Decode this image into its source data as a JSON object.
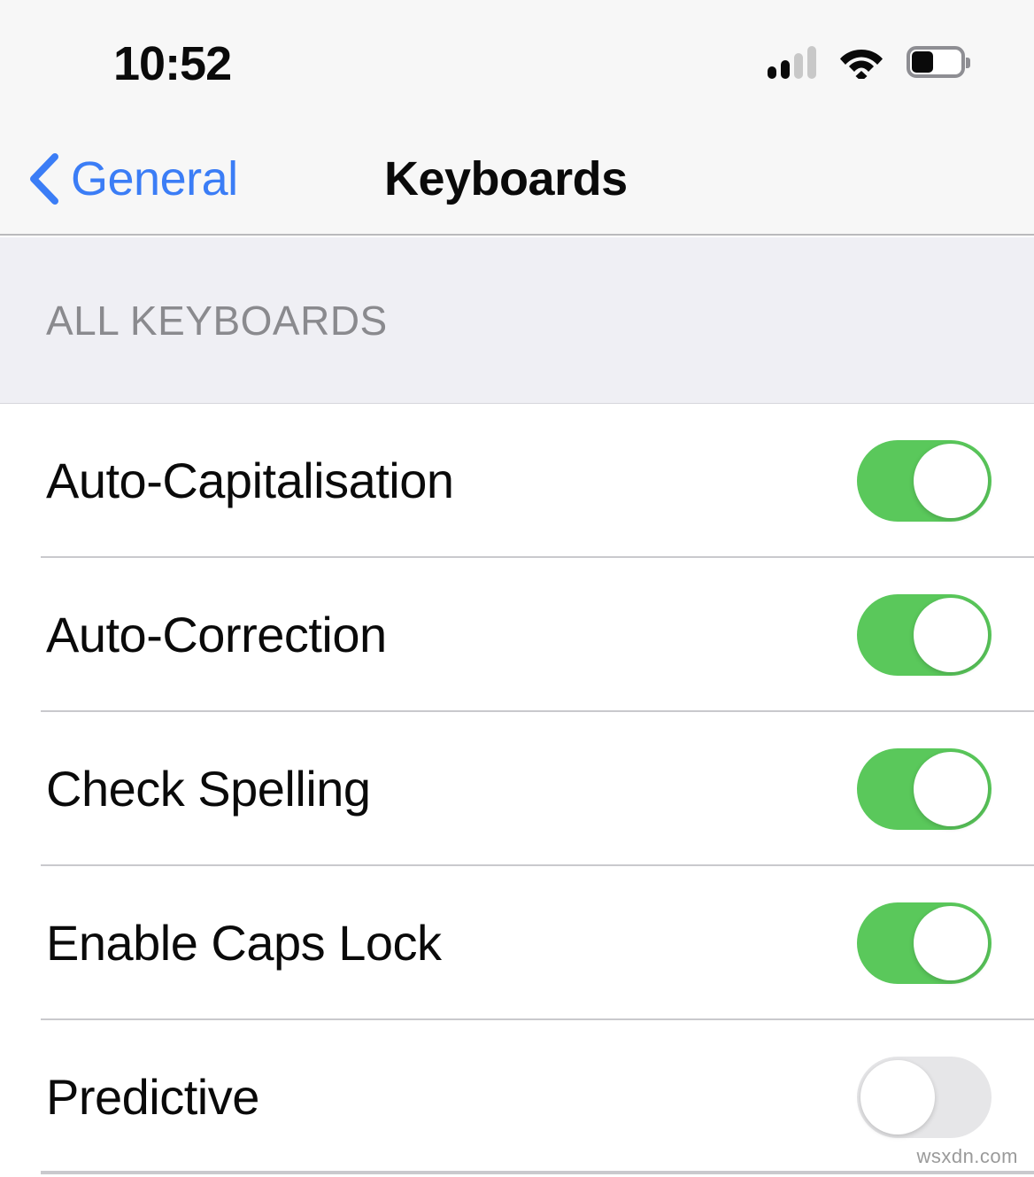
{
  "status_bar": {
    "time": "10:52",
    "cellular_icon": "signal-bars-icon",
    "cellular_bars_filled": 2,
    "cellular_bars_total": 4,
    "wifi_icon": "wifi-icon",
    "wifi_strength": "full",
    "battery_icon": "battery-icon",
    "battery_level_percent": 40
  },
  "nav_bar": {
    "back_icon": "chevron-left-icon",
    "back_label": "General",
    "title": "Keyboards",
    "accent_color": "#3B7DF6"
  },
  "section": {
    "header": "ALL KEYBOARDS",
    "header_color": "#8A8A8E",
    "background_color": "#EFEFF4"
  },
  "rows": [
    {
      "label": "Auto-Capitalisation",
      "toggle": "on",
      "toggle_name": "auto-capitalisation-toggle"
    },
    {
      "label": "Auto-Correction",
      "toggle": "on",
      "toggle_name": "auto-correction-toggle"
    },
    {
      "label": "Check Spelling",
      "toggle": "on",
      "toggle_name": "check-spelling-toggle"
    },
    {
      "label": "Enable Caps Lock",
      "toggle": "on",
      "toggle_name": "enable-caps-lock-toggle"
    },
    {
      "label": "Predictive",
      "toggle": "off",
      "toggle_name": "predictive-toggle"
    }
  ],
  "colors": {
    "toggle_on": "#5AC85B",
    "toggle_off": "#E6E6E8",
    "separator": "#C9C9CD"
  },
  "watermark": "wsxdn.com"
}
